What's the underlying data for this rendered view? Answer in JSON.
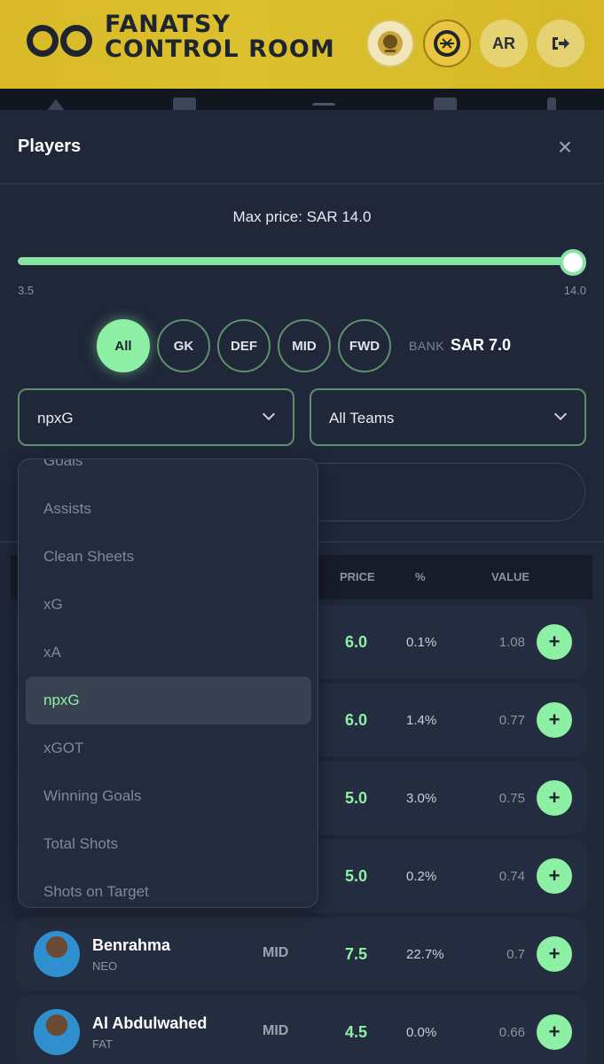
{
  "header": {
    "logo_line1": "FANATSY",
    "logo_line2": "CONTROL ROOM",
    "lang_label": "AR",
    "club1_icon": "club-crest-icon",
    "club2_icon": "club-crest-icon",
    "logout_icon": "logout-icon"
  },
  "sheet": {
    "title": "Players",
    "close_label": "×"
  },
  "price_filter": {
    "label": "Max price: SAR 14.0",
    "min_label": "3.5",
    "max_label": "14.0",
    "value_fraction": 1.0
  },
  "positions": [
    "All",
    "GK",
    "DEF",
    "MID",
    "FWD"
  ],
  "active_position": "All",
  "bank": {
    "label": "BANK",
    "value": "SAR 7.0"
  },
  "sort_select": {
    "value": "npxG"
  },
  "team_select": {
    "value": "All Teams"
  },
  "table": {
    "headers": {
      "price": "PRICE",
      "percent": "%",
      "value": "VALUE"
    }
  },
  "rows": [
    {
      "name": "",
      "team": "",
      "pos": "",
      "price": "6.0",
      "pct": "0.1%",
      "value": "1.08"
    },
    {
      "name": "",
      "team": "",
      "pos": "",
      "price": "6.0",
      "pct": "1.4%",
      "value": "0.77"
    },
    {
      "name": "",
      "team": "",
      "pos": "",
      "price": "5.0",
      "pct": "3.0%",
      "value": "0.75"
    },
    {
      "name": "",
      "team": "",
      "pos": "",
      "price": "5.0",
      "pct": "0.2%",
      "value": "0.74"
    },
    {
      "name": "Benrahma",
      "team": "NEO",
      "pos": "MID",
      "price": "7.5",
      "pct": "22.7%",
      "value": "0.7"
    },
    {
      "name": "Al Abdulwahed",
      "team": "FAT",
      "pos": "MID",
      "price": "4.5",
      "pct": "0.0%",
      "value": "0.66"
    }
  ],
  "add_label": "+",
  "dropdown": {
    "items": [
      "Goals",
      "Assists",
      "Clean Sheets",
      "xG",
      "xA",
      "npxG",
      "xGOT",
      "Winning Goals",
      "Total Shots",
      "Shots on Target"
    ],
    "selected": "npxG"
  },
  "colors": {
    "accent": "#8ef0a4",
    "header_bg": "#dcc02e",
    "page_bg": "#1f2738"
  }
}
